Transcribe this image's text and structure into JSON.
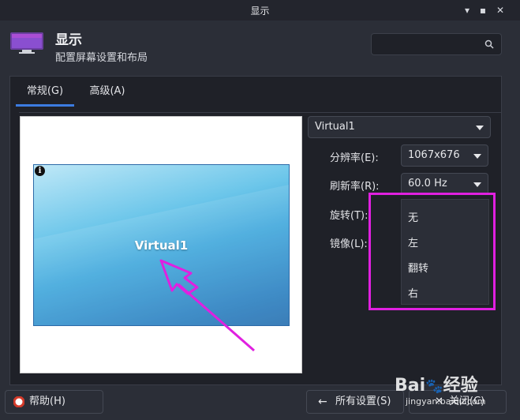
{
  "window": {
    "title": "显示",
    "controls": [
      "minimize-icon",
      "maximize-icon",
      "close-icon"
    ]
  },
  "header": {
    "app_name": "显示",
    "subtitle": "配置屏幕设置和布局",
    "search_placeholder": ""
  },
  "tabs": [
    {
      "label": "常规(G)",
      "active": true
    },
    {
      "label": "高级(A)",
      "active": false
    }
  ],
  "preview": {
    "display_name": "Virtual1",
    "info_icon_text": "i"
  },
  "settings": {
    "display_select": "Virtual1",
    "resolution_label": "分辨率(E):",
    "resolution_value": "1067x676",
    "refresh_label": "刷新率(R):",
    "refresh_value": "60.0 Hz",
    "rotation_label": "旋转(T):",
    "mirror_label": "镜像(L):"
  },
  "rotation_options": [
    "无",
    "左",
    "翻转",
    "右"
  ],
  "footer": {
    "help_label": "帮助(H)",
    "all_settings_label": "所有设置(S)",
    "close_label": "关闭(C)"
  },
  "watermark": {
    "brand": "Bai",
    "brand2": "经验",
    "url": "jingyan.baidu.com"
  },
  "colors": {
    "accent": "#3c7ce0",
    "annotation": "#e020e0",
    "background": "#2b2e37"
  }
}
